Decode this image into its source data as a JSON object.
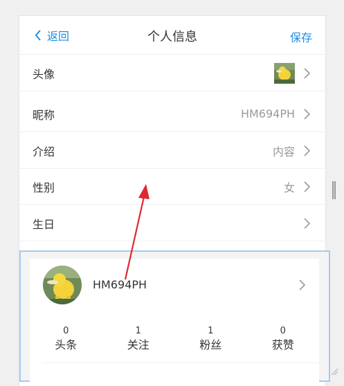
{
  "header": {
    "back_label": "返回",
    "title": "个人信息",
    "save_label": "保存"
  },
  "rows": [
    {
      "label": "头像",
      "value": ""
    },
    {
      "label": "昵称",
      "value": "HM694PH"
    },
    {
      "label": "介绍",
      "value": "内容"
    },
    {
      "label": "性别",
      "value": "女"
    },
    {
      "label": "生日",
      "value": ""
    }
  ],
  "profile_card": {
    "name": "HM694PH",
    "stats": [
      {
        "count": "0",
        "label": "头条"
      },
      {
        "count": "1",
        "label": "关注"
      },
      {
        "count": "1",
        "label": "粉丝"
      },
      {
        "count": "0",
        "label": "获赞"
      }
    ]
  },
  "colors": {
    "accent": "#1a8fe3",
    "annotation_arrow": "#e0282e"
  }
}
